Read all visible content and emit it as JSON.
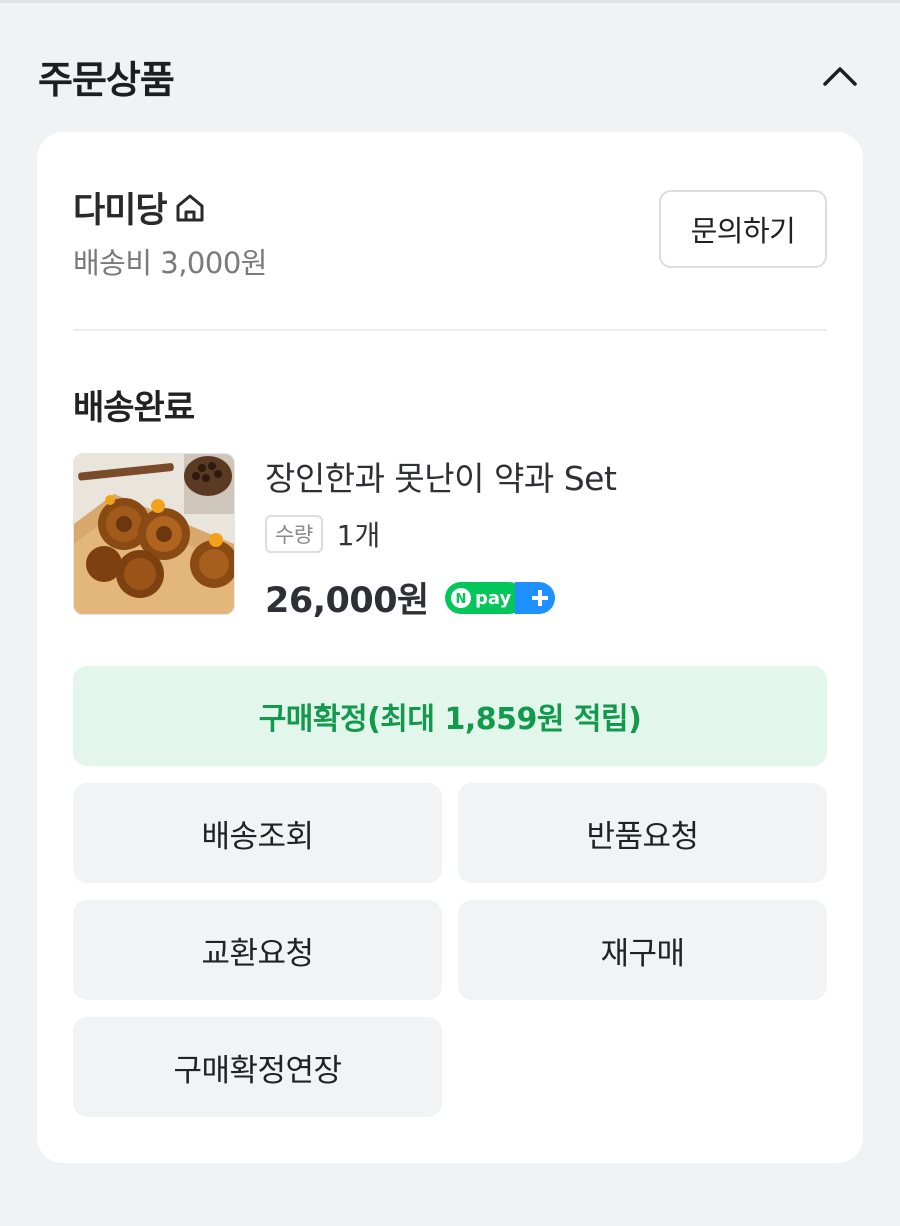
{
  "section": {
    "title": "주문상품"
  },
  "seller": {
    "name": "다미당",
    "shipping_fee": "배송비 3,000원",
    "inquiry_label": "문의하기"
  },
  "order": {
    "status": "배송완료",
    "product": {
      "name": "장인한과 못난이 약과 Set",
      "qty_label": "수량",
      "qty_value": "1개",
      "price": "26,000원",
      "npay_badge_text": "pay"
    },
    "confirm_label": "구매확정(최대 1,859원 적립)",
    "actions": [
      {
        "label": "배송조회"
      },
      {
        "label": "반품요청"
      },
      {
        "label": "교환요청"
      },
      {
        "label": "재구매"
      },
      {
        "label": "구매확정연장"
      }
    ]
  },
  "colors": {
    "background": "#f1f2f4",
    "card": "#ffffff",
    "confirm_bg": "#e3f6ec",
    "confirm_text": "#129a4c",
    "npay_green": "#03c75a",
    "npay_blue": "#1e90ff"
  },
  "icons": {
    "collapse": "chevron-up-icon",
    "store": "home-icon",
    "npay": "npay-plus-icon"
  }
}
